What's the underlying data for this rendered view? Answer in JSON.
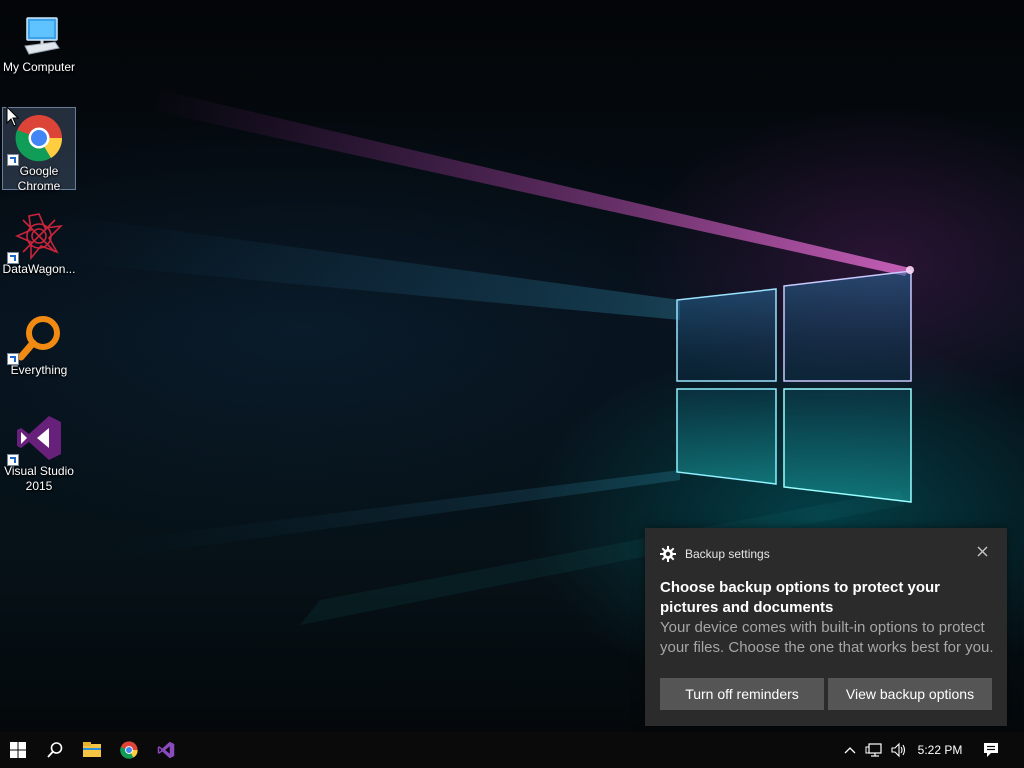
{
  "desktop": {
    "icons": [
      {
        "label": "My Computer",
        "icon": "computer-icon"
      },
      {
        "label": "Google Chrome",
        "icon": "chrome-icon",
        "selected": true
      },
      {
        "label": "DataWagon...",
        "icon": "datawagon-icon"
      },
      {
        "label": "Everything",
        "icon": "everything-icon"
      },
      {
        "label": "Visual Studio 2015",
        "icon": "visual-studio-icon"
      }
    ]
  },
  "toast": {
    "app_name": "Backup settings",
    "title": "Choose backup options to protect your pictures and documents",
    "body": "Your device comes with built-in options to protect your files. Choose the one that works best for you.",
    "button_turn_off": "Turn off reminders",
    "button_view": "View backup options"
  },
  "taskbar": {
    "pinned": [
      "start-icon",
      "search-icon",
      "file-explorer-icon",
      "chrome-icon",
      "visual-studio-icon"
    ],
    "tray": [
      "chevron-up-icon",
      "network-icon",
      "volume-icon"
    ],
    "clock": "5:22 PM"
  },
  "colors": {
    "toast_bg": "#2b2b2b",
    "toast_button": "#555555",
    "taskbar_bg": "#0a0a0a"
  }
}
